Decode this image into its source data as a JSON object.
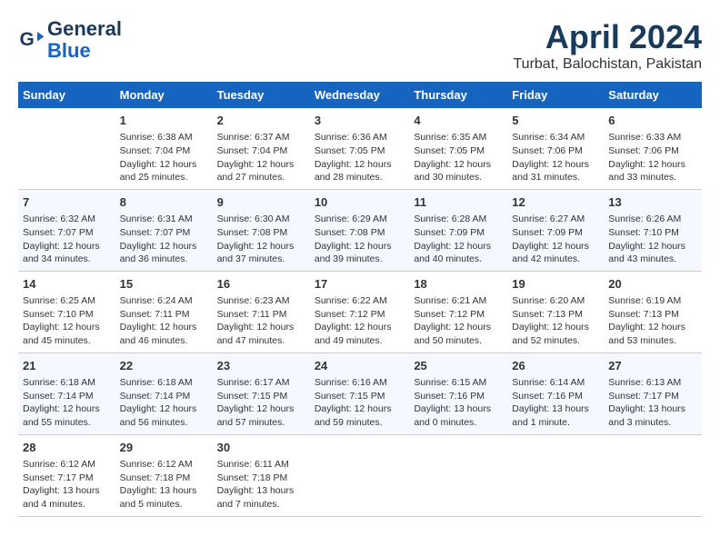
{
  "header": {
    "logo_line1": "General",
    "logo_line2": "Blue",
    "month": "April 2024",
    "location": "Turbat, Balochistan, Pakistan"
  },
  "days_of_week": [
    "Sunday",
    "Monday",
    "Tuesday",
    "Wednesday",
    "Thursday",
    "Friday",
    "Saturday"
  ],
  "weeks": [
    [
      {
        "num": "",
        "info": ""
      },
      {
        "num": "1",
        "info": "Sunrise: 6:38 AM\nSunset: 7:04 PM\nDaylight: 12 hours\nand 25 minutes."
      },
      {
        "num": "2",
        "info": "Sunrise: 6:37 AM\nSunset: 7:04 PM\nDaylight: 12 hours\nand 27 minutes."
      },
      {
        "num": "3",
        "info": "Sunrise: 6:36 AM\nSunset: 7:05 PM\nDaylight: 12 hours\nand 28 minutes."
      },
      {
        "num": "4",
        "info": "Sunrise: 6:35 AM\nSunset: 7:05 PM\nDaylight: 12 hours\nand 30 minutes."
      },
      {
        "num": "5",
        "info": "Sunrise: 6:34 AM\nSunset: 7:06 PM\nDaylight: 12 hours\nand 31 minutes."
      },
      {
        "num": "6",
        "info": "Sunrise: 6:33 AM\nSunset: 7:06 PM\nDaylight: 12 hours\nand 33 minutes."
      }
    ],
    [
      {
        "num": "7",
        "info": "Sunrise: 6:32 AM\nSunset: 7:07 PM\nDaylight: 12 hours\nand 34 minutes."
      },
      {
        "num": "8",
        "info": "Sunrise: 6:31 AM\nSunset: 7:07 PM\nDaylight: 12 hours\nand 36 minutes."
      },
      {
        "num": "9",
        "info": "Sunrise: 6:30 AM\nSunset: 7:08 PM\nDaylight: 12 hours\nand 37 minutes."
      },
      {
        "num": "10",
        "info": "Sunrise: 6:29 AM\nSunset: 7:08 PM\nDaylight: 12 hours\nand 39 minutes."
      },
      {
        "num": "11",
        "info": "Sunrise: 6:28 AM\nSunset: 7:09 PM\nDaylight: 12 hours\nand 40 minutes."
      },
      {
        "num": "12",
        "info": "Sunrise: 6:27 AM\nSunset: 7:09 PM\nDaylight: 12 hours\nand 42 minutes."
      },
      {
        "num": "13",
        "info": "Sunrise: 6:26 AM\nSunset: 7:10 PM\nDaylight: 12 hours\nand 43 minutes."
      }
    ],
    [
      {
        "num": "14",
        "info": "Sunrise: 6:25 AM\nSunset: 7:10 PM\nDaylight: 12 hours\nand 45 minutes."
      },
      {
        "num": "15",
        "info": "Sunrise: 6:24 AM\nSunset: 7:11 PM\nDaylight: 12 hours\nand 46 minutes."
      },
      {
        "num": "16",
        "info": "Sunrise: 6:23 AM\nSunset: 7:11 PM\nDaylight: 12 hours\nand 47 minutes."
      },
      {
        "num": "17",
        "info": "Sunrise: 6:22 AM\nSunset: 7:12 PM\nDaylight: 12 hours\nand 49 minutes."
      },
      {
        "num": "18",
        "info": "Sunrise: 6:21 AM\nSunset: 7:12 PM\nDaylight: 12 hours\nand 50 minutes."
      },
      {
        "num": "19",
        "info": "Sunrise: 6:20 AM\nSunset: 7:13 PM\nDaylight: 12 hours\nand 52 minutes."
      },
      {
        "num": "20",
        "info": "Sunrise: 6:19 AM\nSunset: 7:13 PM\nDaylight: 12 hours\nand 53 minutes."
      }
    ],
    [
      {
        "num": "21",
        "info": "Sunrise: 6:18 AM\nSunset: 7:14 PM\nDaylight: 12 hours\nand 55 minutes."
      },
      {
        "num": "22",
        "info": "Sunrise: 6:18 AM\nSunset: 7:14 PM\nDaylight: 12 hours\nand 56 minutes."
      },
      {
        "num": "23",
        "info": "Sunrise: 6:17 AM\nSunset: 7:15 PM\nDaylight: 12 hours\nand 57 minutes."
      },
      {
        "num": "24",
        "info": "Sunrise: 6:16 AM\nSunset: 7:15 PM\nDaylight: 12 hours\nand 59 minutes."
      },
      {
        "num": "25",
        "info": "Sunrise: 6:15 AM\nSunset: 7:16 PM\nDaylight: 13 hours\nand 0 minutes."
      },
      {
        "num": "26",
        "info": "Sunrise: 6:14 AM\nSunset: 7:16 PM\nDaylight: 13 hours\nand 1 minute."
      },
      {
        "num": "27",
        "info": "Sunrise: 6:13 AM\nSunset: 7:17 PM\nDaylight: 13 hours\nand 3 minutes."
      }
    ],
    [
      {
        "num": "28",
        "info": "Sunrise: 6:12 AM\nSunset: 7:17 PM\nDaylight: 13 hours\nand 4 minutes."
      },
      {
        "num": "29",
        "info": "Sunrise: 6:12 AM\nSunset: 7:18 PM\nDaylight: 13 hours\nand 5 minutes."
      },
      {
        "num": "30",
        "info": "Sunrise: 6:11 AM\nSunset: 7:18 PM\nDaylight: 13 hours\nand 7 minutes."
      },
      {
        "num": "",
        "info": ""
      },
      {
        "num": "",
        "info": ""
      },
      {
        "num": "",
        "info": ""
      },
      {
        "num": "",
        "info": ""
      }
    ]
  ]
}
